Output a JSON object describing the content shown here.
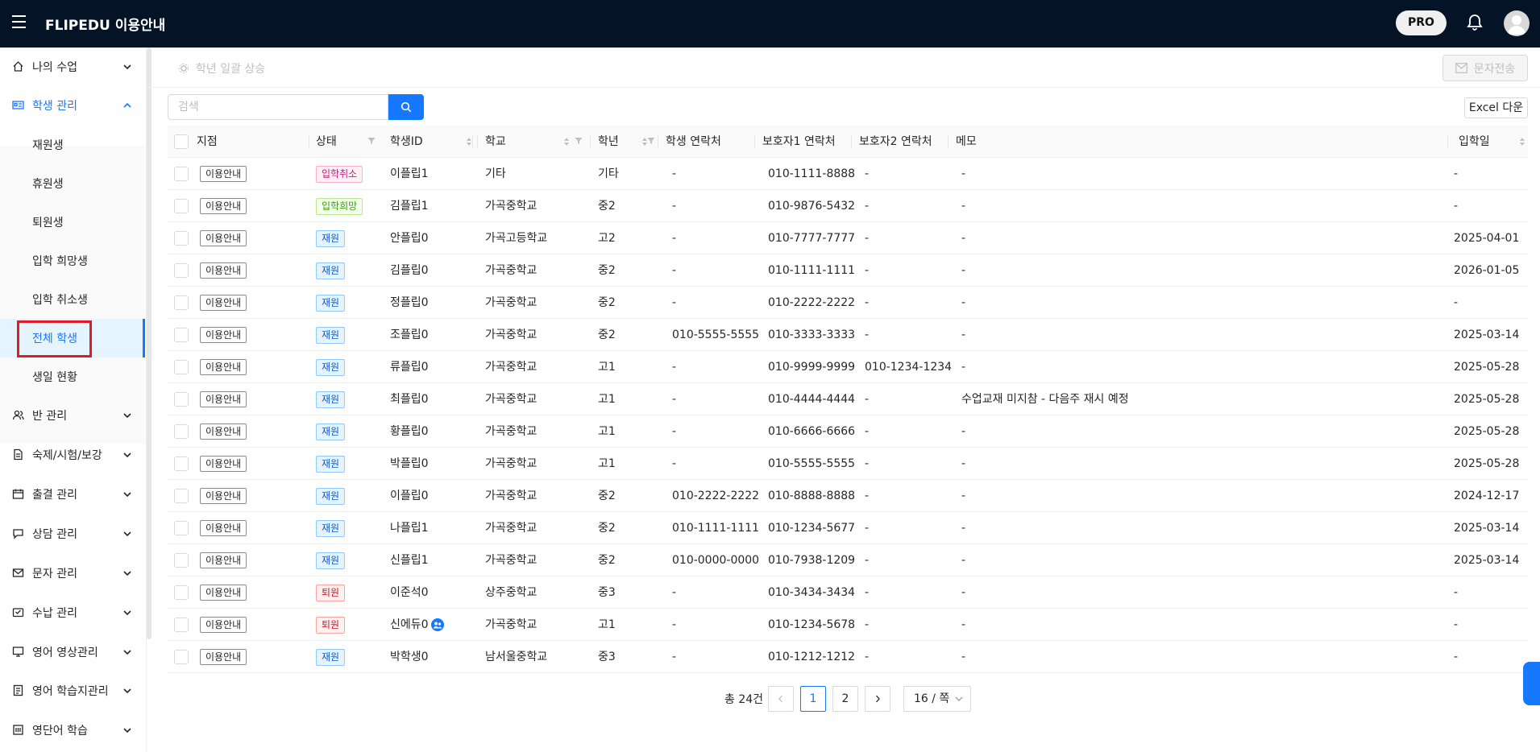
{
  "header": {
    "brand_name": "FLIPEDU",
    "brand_sub": "이용안내",
    "pro_label": "PRO",
    "icons": [
      "menu-icon",
      "bell-icon",
      "user-avatar-icon"
    ]
  },
  "sidebar": {
    "items": [
      {
        "label": "나의 수업",
        "icon": "home-icon"
      },
      {
        "label": "학생 관리",
        "icon": "id-card-icon"
      },
      {
        "label": "반 관리",
        "icon": "users-icon"
      },
      {
        "label": "숙제/시험/보강",
        "icon": "document-icon"
      },
      {
        "label": "출결 관리",
        "icon": "calendar-icon"
      },
      {
        "label": "상담 관리",
        "icon": "chat-icon"
      },
      {
        "label": "문자 관리",
        "icon": "mail-icon"
      },
      {
        "label": "수납 관리",
        "icon": "wallet-icon"
      },
      {
        "label": "영어 영상관리",
        "icon": "monitor-icon"
      },
      {
        "label": "영어 학습지관리",
        "icon": "book-icon"
      },
      {
        "label": "영단어 학습",
        "icon": "dictionary-icon"
      }
    ],
    "student_submenu": [
      "재원생",
      "휴원생",
      "퇴원생",
      "입학 희망생",
      "입학 취소생",
      "전체 학생",
      "생일 현황"
    ],
    "selected_submenu": "전체 학생"
  },
  "toolbar": {
    "bulk_grade_label": "학년 일괄 상승",
    "sms_label": "문자전송",
    "search_placeholder": "검색",
    "excel_label": "Excel 다운"
  },
  "table": {
    "columns": [
      "지점",
      "상태",
      "학생ID",
      "학교",
      "학년",
      "학생 연락처",
      "보호자1 연락처",
      "보호자2 연락처",
      "메모",
      "입학일"
    ],
    "rows": [
      {
        "branch": "이용안내",
        "status": "입학취소",
        "status_type": "cancel",
        "id": "이플립1",
        "school": "기타",
        "grade": "기타",
        "student_phone": "-",
        "parent1": "010-1111-8888",
        "parent2": "-",
        "memo": "-",
        "date": "-"
      },
      {
        "branch": "이용안내",
        "status": "입학희망",
        "status_type": "hope",
        "id": "김플립1",
        "school": "가곡중학교",
        "grade": "중2",
        "student_phone": "-",
        "parent1": "010-9876-5432",
        "parent2": "-",
        "memo": "-",
        "date": "-"
      },
      {
        "branch": "이용안내",
        "status": "재원",
        "status_type": "enrolled",
        "id": "안플립0",
        "school": "가곡고등학교",
        "grade": "고2",
        "student_phone": "-",
        "parent1": "010-7777-7777",
        "parent2": "-",
        "memo": "-",
        "date": "2025-04-01"
      },
      {
        "branch": "이용안내",
        "status": "재원",
        "status_type": "enrolled",
        "id": "김플립0",
        "school": "가곡중학교",
        "grade": "중2",
        "student_phone": "-",
        "parent1": "010-1111-1111",
        "parent2": "-",
        "memo": "-",
        "date": "2026-01-05"
      },
      {
        "branch": "이용안내",
        "status": "재원",
        "status_type": "enrolled",
        "id": "정플립0",
        "school": "가곡중학교",
        "grade": "중2",
        "student_phone": "-",
        "parent1": "010-2222-2222",
        "parent2": "-",
        "memo": "-",
        "date": "-"
      },
      {
        "branch": "이용안내",
        "status": "재원",
        "status_type": "enrolled",
        "id": "조플립0",
        "school": "가곡중학교",
        "grade": "중2",
        "student_phone": "010-5555-5555",
        "parent1": "010-3333-3333",
        "parent2": "-",
        "memo": "-",
        "date": "2025-03-14"
      },
      {
        "branch": "이용안내",
        "status": "재원",
        "status_type": "enrolled",
        "id": "류플립0",
        "school": "가곡중학교",
        "grade": "고1",
        "student_phone": "-",
        "parent1": "010-9999-9999",
        "parent2": "010-1234-1234",
        "memo": "-",
        "date": "2025-05-28"
      },
      {
        "branch": "이용안내",
        "status": "재원",
        "status_type": "enrolled",
        "id": "최플립0",
        "school": "가곡중학교",
        "grade": "고1",
        "student_phone": "-",
        "parent1": "010-4444-4444",
        "parent2": "-",
        "memo": "수업교재 미지참 - 다음주 재시 예정",
        "date": "2025-05-28"
      },
      {
        "branch": "이용안내",
        "status": "재원",
        "status_type": "enrolled",
        "id": "황플립0",
        "school": "가곡중학교",
        "grade": "고1",
        "student_phone": "-",
        "parent1": "010-6666-6666",
        "parent2": "-",
        "memo": "-",
        "date": "2025-05-28"
      },
      {
        "branch": "이용안내",
        "status": "재원",
        "status_type": "enrolled",
        "id": "박플립0",
        "school": "가곡중학교",
        "grade": "고1",
        "student_phone": "-",
        "parent1": "010-5555-5555",
        "parent2": "-",
        "memo": "-",
        "date": "2025-05-28"
      },
      {
        "branch": "이용안내",
        "status": "재원",
        "status_type": "enrolled",
        "id": "이플립0",
        "school": "가곡중학교",
        "grade": "중2",
        "student_phone": "010-2222-2222",
        "parent1": "010-8888-8888",
        "parent2": "-",
        "memo": "-",
        "date": "2024-12-17"
      },
      {
        "branch": "이용안내",
        "status": "재원",
        "status_type": "enrolled",
        "id": "나플립1",
        "school": "가곡중학교",
        "grade": "중2",
        "student_phone": "010-1111-1111",
        "parent1": "010-1234-5677",
        "parent2": "-",
        "memo": "-",
        "date": "2025-03-14"
      },
      {
        "branch": "이용안내",
        "status": "재원",
        "status_type": "enrolled",
        "id": "신플립1",
        "school": "가곡중학교",
        "grade": "중2",
        "student_phone": "010-0000-0000",
        "parent1": "010-7938-1209",
        "parent2": "-",
        "memo": "-",
        "date": "2025-03-14"
      },
      {
        "branch": "이용안내",
        "status": "퇴원",
        "status_type": "left",
        "id": "이준석0",
        "school": "상주중학교",
        "grade": "중3",
        "student_phone": "-",
        "parent1": "010-3434-3434",
        "parent2": "-",
        "memo": "-",
        "date": "-"
      },
      {
        "branch": "이용안내",
        "status": "퇴원",
        "status_type": "left",
        "id": "신에듀0",
        "school": "가곡중학교",
        "grade": "고1",
        "student_phone": "-",
        "parent1": "010-1234-5678",
        "parent2": "-",
        "memo": "-",
        "date": "-",
        "has_sibling_icon": true
      },
      {
        "branch": "이용안내",
        "status": "재원",
        "status_type": "enrolled",
        "id": "박학생0",
        "school": "남서울중학교",
        "grade": "중3",
        "student_phone": "-",
        "parent1": "010-1212-1212",
        "parent2": "-",
        "memo": "-",
        "date": "-"
      }
    ]
  },
  "pagination": {
    "total_label": "총 24건",
    "pages": [
      "1",
      "2"
    ],
    "current_page": "1",
    "page_size_label": "16 / 쪽"
  },
  "colors": {
    "topbar": "#041426",
    "accent": "#1677ff",
    "status_cancel": "#c41d7f",
    "status_hope": "#389e0d",
    "status_enrolled": "#0958d9",
    "status_left": "#cf1322",
    "highlight_box": "#e01b24"
  }
}
